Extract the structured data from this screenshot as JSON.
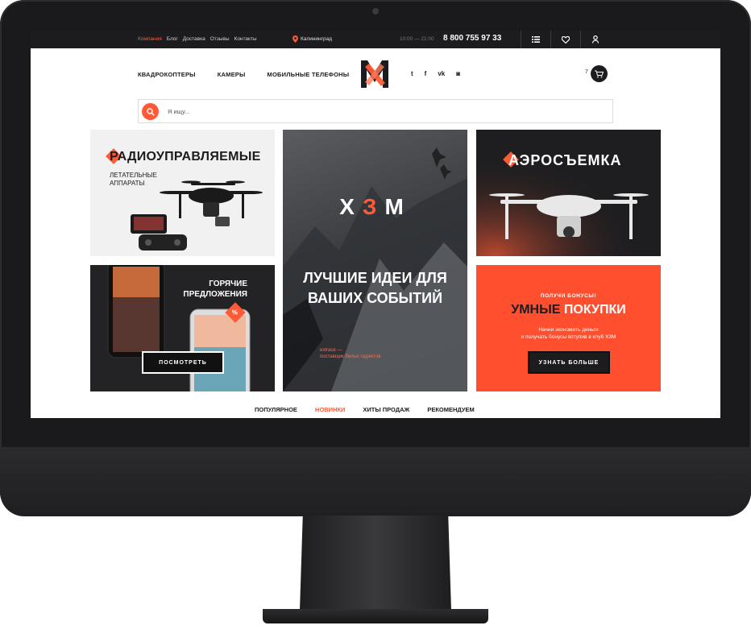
{
  "topbar": {
    "nav": [
      "Компания",
      "Блог",
      "Доставка",
      "Отзывы",
      "Контакты"
    ],
    "active_nav": "Компания",
    "city": "Калининград",
    "hours": "10:00 — 21:00",
    "phone": "8 800 755 97 33",
    "icons": [
      "list-icon",
      "heart-icon",
      "user-icon"
    ]
  },
  "header": {
    "nav": [
      "КВАДРОКОПТЕРЫ",
      "КАМЕРЫ",
      "МОБИЛЬНЫЕ ТЕЛЕФОНЫ"
    ],
    "social": [
      {
        "icon": "twitter-icon",
        "glyph": "t"
      },
      {
        "icon": "facebook-icon",
        "glyph": "f"
      },
      {
        "icon": "vk-icon",
        "glyph": "vk"
      },
      {
        "icon": "instagram-icon",
        "glyph": "◙"
      }
    ],
    "cart_count": "7"
  },
  "search": {
    "placeholder": "Я ищу..."
  },
  "tiles": {
    "drones": {
      "title": "РАДИОУПРАВЛЯЕМЫЕ",
      "subtitle": "ЛЕТАТЕЛЬНЫЕ АППАРАТЫ"
    },
    "hero": {
      "logo_x": "X",
      "logo_z": "З",
      "logo_m": "M",
      "headline": "ЛУЧШИЕ ИДЕИ ДЛЯ ВАШИХ СОБЫТИЙ",
      "note_1": "extrace —",
      "note_2": "поставщик белых гаджетов"
    },
    "aerial": {
      "title": "АЭРОСЪЕМКА"
    },
    "hot": {
      "title": "ГОРЯЧИЕ ПРЕДЛОЖЕНИЯ",
      "button": "ПОСМОТРЕТЬ"
    },
    "bonus": {
      "kicker": "ПОЛУЧИ БОНУСЫ!",
      "title_a": "УМНЫЕ ",
      "title_b": "ПОКУПКИ",
      "text_1": "Начни экономить деньги",
      "text_2": "и получать бонусы вступив в клуб X3M",
      "button": "УЗНАТЬ БОЛЬШЕ"
    }
  },
  "tabs": [
    "ПОПУЛЯРНОЕ",
    "НОВИНКИ",
    "ХИТЫ ПРОДАЖ",
    "РЕКОМЕНДУЕМ"
  ],
  "active_tab": "НОВИНКИ",
  "colors": {
    "accent": "#ff5a36",
    "dark": "#1c1c1e"
  }
}
